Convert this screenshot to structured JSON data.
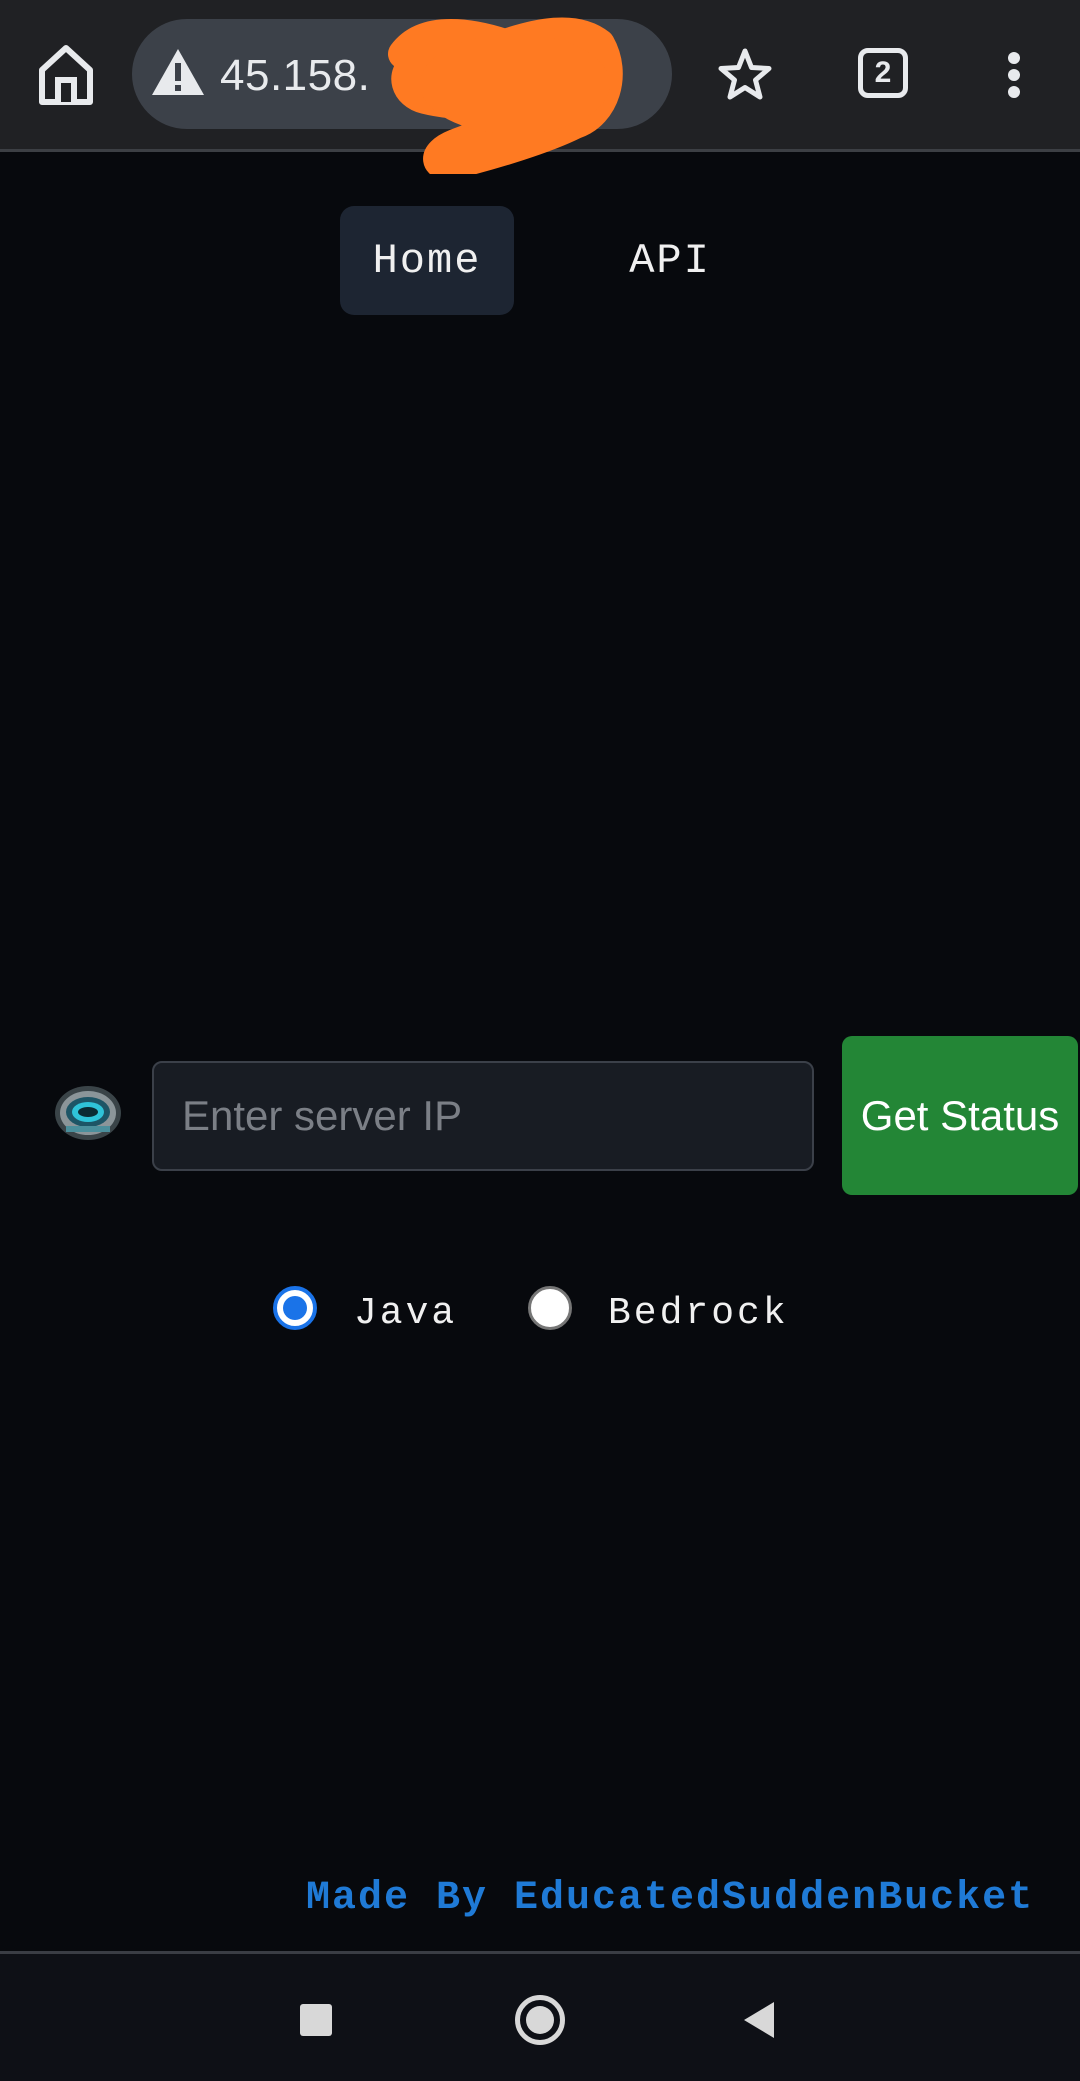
{
  "browser": {
    "url_text": "45.158.",
    "tab_count": "2",
    "icons": [
      "home-icon",
      "warning-icon",
      "star-icon",
      "tabs-icon",
      "more-vert-icon"
    ]
  },
  "nav": {
    "home_label": "Home",
    "api_label": "API"
  },
  "search": {
    "placeholder": "Enter server IP",
    "value": "",
    "button_label": "Get Status"
  },
  "edition": {
    "selected": "Java",
    "options": [
      {
        "label": "Java",
        "checked": true
      },
      {
        "label": "Bedrock",
        "checked": false
      }
    ]
  },
  "footer": {
    "credit": "Made By EducatedSuddenBucket"
  },
  "colors": {
    "background": "#07090d",
    "nav_active": "#1d2532",
    "button": "#238636",
    "credit": "#1f7ad6",
    "radio_accent": "#1a73e8",
    "redaction": "#ff7a22"
  },
  "system_nav": {
    "icons": [
      "recents-icon",
      "home-circle-icon",
      "back-icon"
    ]
  }
}
